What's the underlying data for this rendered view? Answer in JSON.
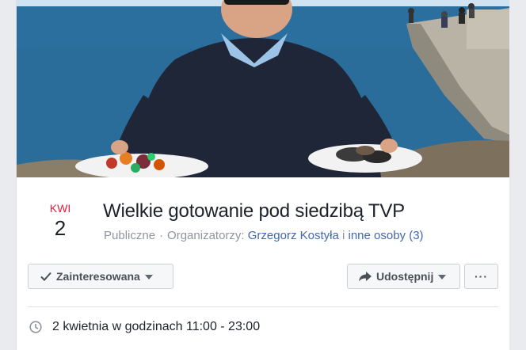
{
  "event": {
    "cover_alt_name": "event-cover-photo",
    "date_month": "KWI",
    "date_day": "2",
    "title": "Wielkie gotowanie pod siedzibą TVP",
    "privacy": "Publiczne",
    "separator": "·",
    "organizers_label": "Organizatorzy:",
    "organizer_name": "Grzegorz Kostyła",
    "organizer_join": "i",
    "organizer_others": "inne osoby (3)",
    "time_text": "2 kwietnia w godzinach 11:00 - 23:00"
  },
  "actions": {
    "interested_label": "Zainteresowana",
    "share_label": "Udostępnij",
    "more_label": "···"
  },
  "icons": {
    "interested": "checkmark-icon",
    "share": "share-arrow-icon",
    "time": "clock-icon",
    "dropdown": "chevron-down-icon"
  },
  "colors": {
    "month": "#e3203d",
    "link": "#4267b2",
    "meta": "#90949c"
  }
}
